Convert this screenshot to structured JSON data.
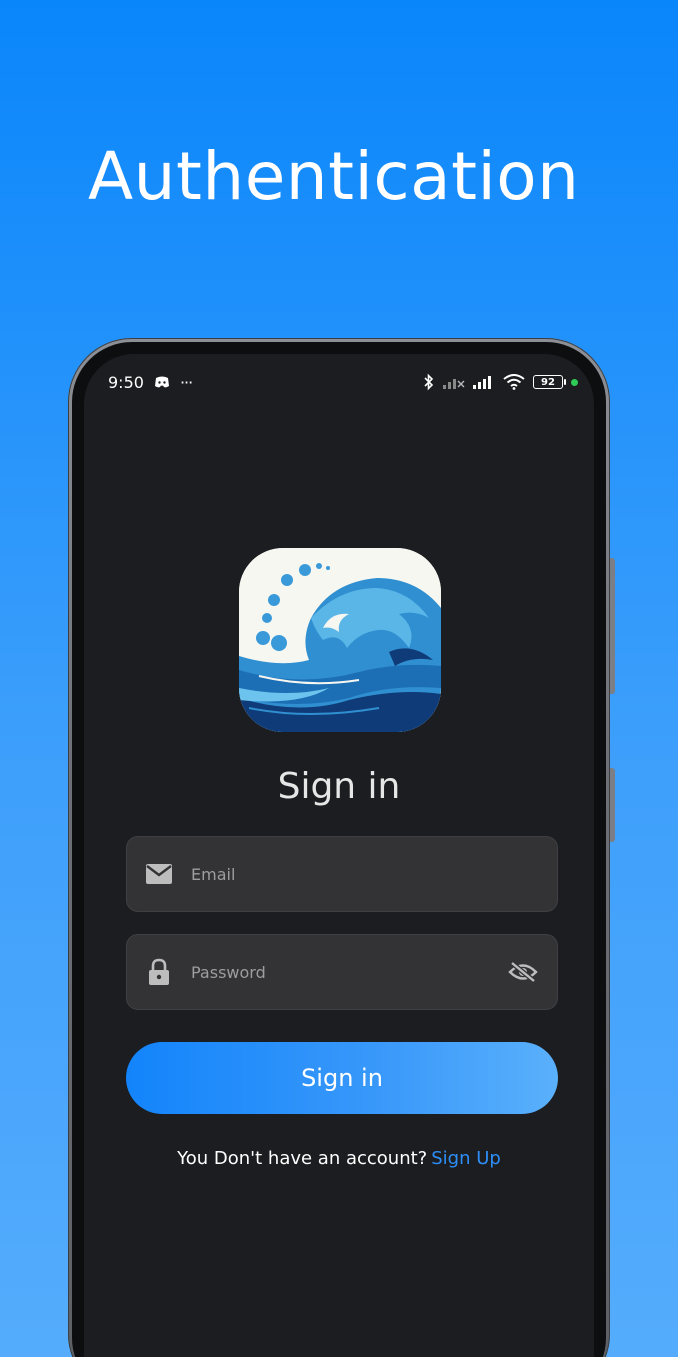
{
  "headline": "Authentication",
  "status_bar": {
    "time": "9:50",
    "more_dots": "···",
    "battery_level": "92",
    "icons": [
      "discord-icon",
      "more-icon",
      "bluetooth-icon",
      "signal-icon",
      "signal-icon",
      "wifi-icon",
      "battery-icon"
    ]
  },
  "logo": {
    "icon": "wave-logo-icon"
  },
  "form": {
    "title": "Sign in",
    "email": {
      "placeholder": "Email",
      "value": ""
    },
    "password": {
      "placeholder": "Password",
      "value": ""
    },
    "submit_label": "Sign in",
    "prompt_text": "You Don't have an account?",
    "signup_link": "Sign Up"
  },
  "colors": {
    "background_top": "#0a86fb",
    "background_bottom": "#55acfc",
    "screen": "#1c1d21",
    "field": "#333336",
    "button": "#1384fb",
    "link": "#2d8ef7"
  }
}
